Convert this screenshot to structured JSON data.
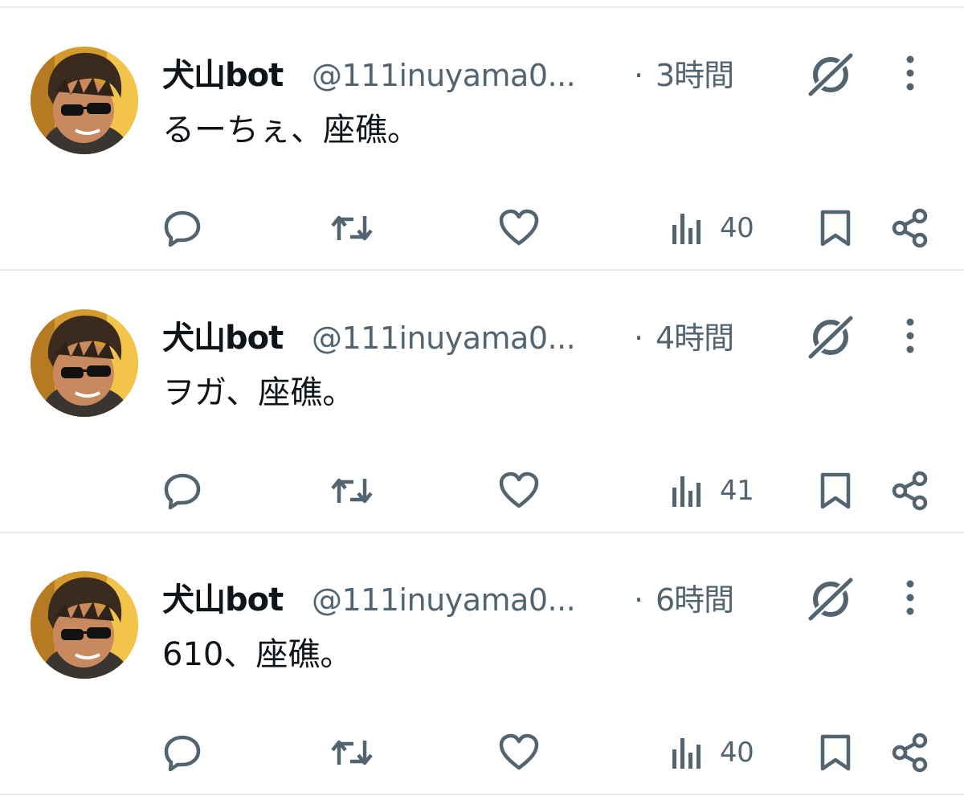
{
  "colors": {
    "text_primary": "#0f1419",
    "text_secondary": "#536471",
    "divider": "#e7e9eb"
  },
  "tweets": [
    {
      "display_name": "犬山bot",
      "handle": "@111inuyama0...",
      "separator": "·",
      "time": "3時間",
      "text": "るーちぇ、座礁。",
      "views": "40"
    },
    {
      "display_name": "犬山bot",
      "handle": "@111inuyama0...",
      "separator": "·",
      "time": "4時間",
      "text": "ヲガ、座礁。",
      "views": "41"
    },
    {
      "display_name": "犬山bot",
      "handle": "@111inuyama0...",
      "separator": "·",
      "time": "6時間",
      "text": "610、座礁。",
      "views": "40"
    }
  ],
  "icons": {
    "grok": "grok-icon",
    "more": "more-vertical-icon",
    "reply": "reply-bubble-icon",
    "retweet": "retweet-icon",
    "like": "heart-icon",
    "views": "bar-chart-icon",
    "bookmark": "bookmark-icon",
    "share": "share-icon"
  }
}
